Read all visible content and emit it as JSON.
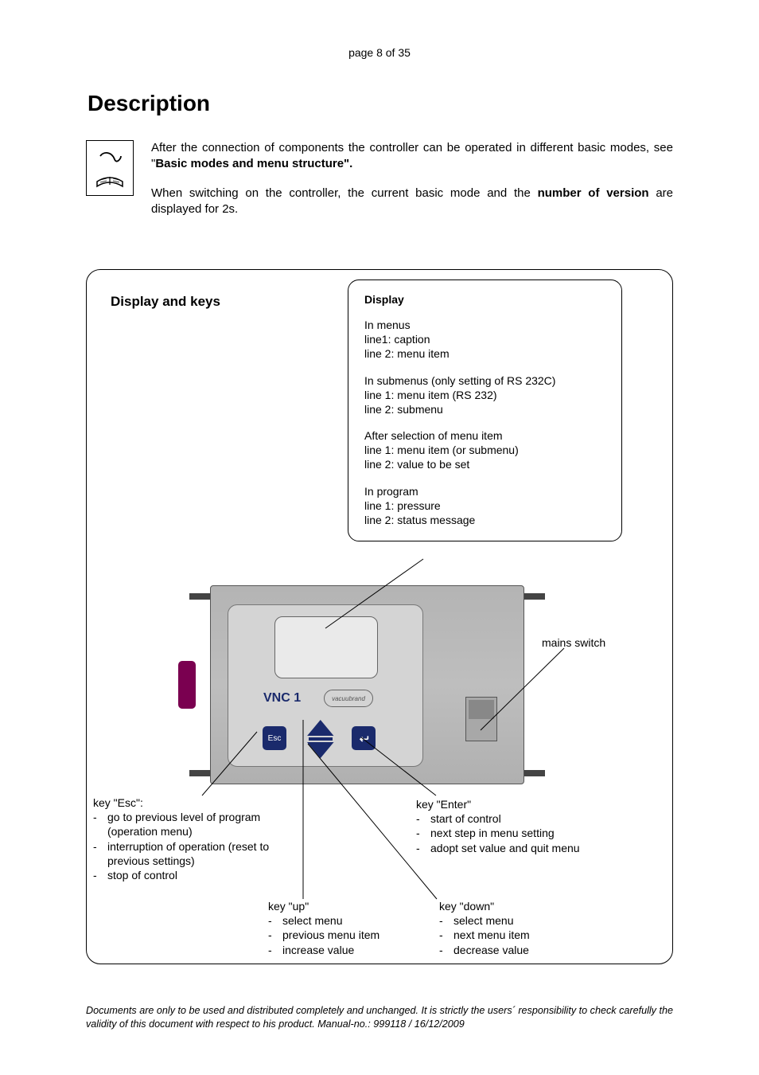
{
  "page_header": "page 8 of 35",
  "heading": "Description",
  "intro": {
    "p1a": "After the connection of components the controller can be operated in different basic modes, see  \"",
    "p1b": "Basic modes and menu structure\".",
    "p2a": "When switching on the controller, the current basic mode and the ",
    "p2b": "number of version",
    "p2c": " are displayed for 2s."
  },
  "diagram": {
    "title": "Display and keys",
    "display_box": {
      "title": "Display",
      "g1l1": "In menus",
      "g1l2": "line1: caption",
      "g1l3": "line 2: menu item",
      "g2l1": "In submenus (only setting of RS 232C)",
      "g2l2": "line 1: menu item (RS 232)",
      "g2l3": "line 2: submenu",
      "g3l1": "After selection of menu item",
      "g3l2": "line 1: menu item (or submenu)",
      "g3l3": "line 2: value to be set",
      "g4l1": "In program",
      "g4l2": "line 1: pressure",
      "g4l3": "line 2: status message"
    },
    "device_label": "VNC 1",
    "device_brand": "vacuubrand",
    "key_esc_text": "Esc",
    "mains": "mains switch",
    "esc": {
      "title": "key \"Esc\":",
      "i1": "go to previous level of program (operation menu)",
      "i2": "interruption of operation (reset to previous settings)",
      "i3": "stop of control"
    },
    "enter": {
      "title": "key \"Enter\"",
      "i1": "start of control",
      "i2": "next step in menu setting",
      "i3": "adopt set value and quit menu"
    },
    "up": {
      "title": "key \"up\"",
      "i1": "select menu",
      "i2": "previous menu item",
      "i3": "increase value"
    },
    "down": {
      "title": "key \"down\"",
      "i1": "select menu",
      "i2": "next menu item",
      "i3": "decrease value"
    }
  },
  "footer": "Documents are only to be used and distributed completely and unchanged. It is strictly the users´ responsibility to check carefully the validity of this document with respect to his product. Manual-no.: 999118 / 16/12/2009"
}
